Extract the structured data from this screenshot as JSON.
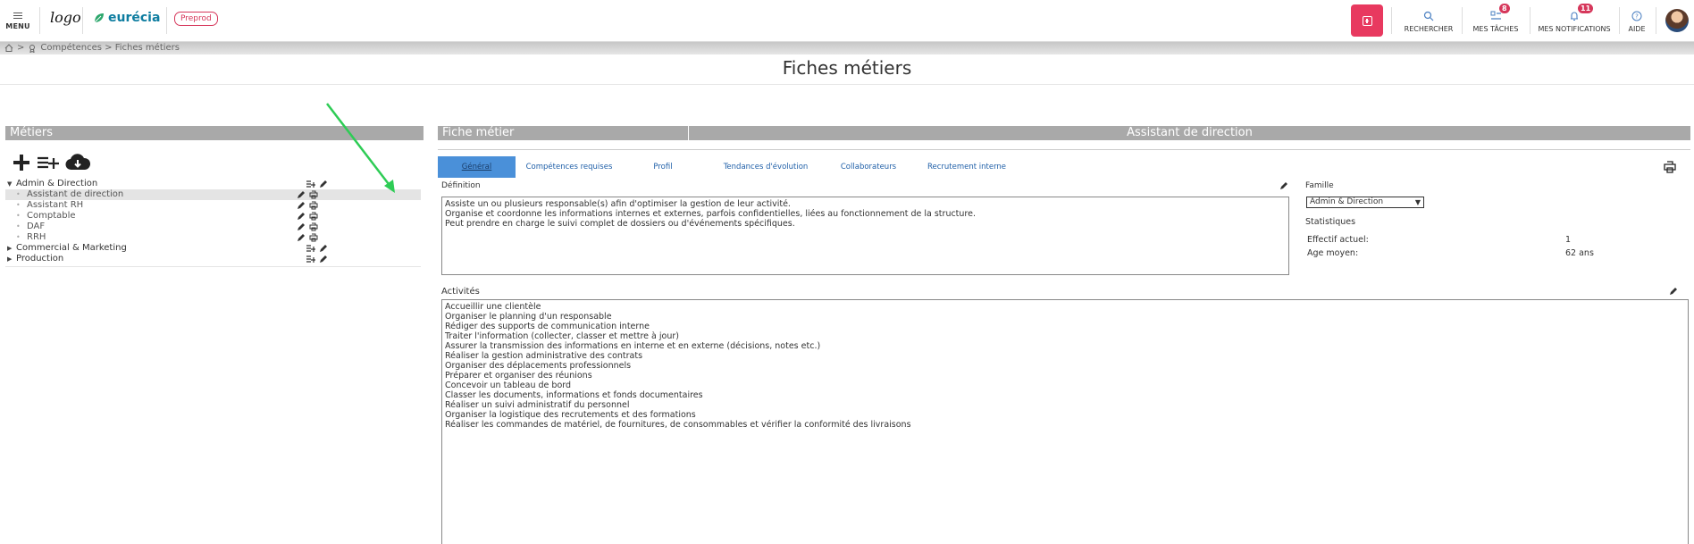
{
  "header": {
    "menu_label": "MENU",
    "logo_text": "logo",
    "brand": "eurécia",
    "env_badge": "Preprod",
    "nav": [
      {
        "label": "RECHERCHER",
        "badge": "",
        "icon": "search-icon"
      },
      {
        "label": "MES TÂCHES",
        "badge": "8",
        "icon": "tasks-icon"
      },
      {
        "label": "MES NOTIFICATIONS",
        "badge": "11",
        "icon": "bell-icon"
      },
      {
        "label": "AIDE",
        "badge": "",
        "icon": "help-icon"
      }
    ]
  },
  "breadcrumb": {
    "sep1": ">",
    "text": "Compétences > Fiches métiers"
  },
  "page_title": "Fiches métiers",
  "left": {
    "title": "Métiers",
    "tree": [
      {
        "label": "Admin & Direction",
        "type": "parent"
      },
      {
        "label": "Assistant de direction",
        "type": "child",
        "selected": true
      },
      {
        "label": "Assistant RH",
        "type": "child"
      },
      {
        "label": "Comptable",
        "type": "child"
      },
      {
        "label": "DAF",
        "type": "child"
      },
      {
        "label": "RRH",
        "type": "child"
      },
      {
        "label": "Commercial & Marketing",
        "type": "parent"
      },
      {
        "label": "Production",
        "type": "parent"
      }
    ]
  },
  "right": {
    "header_left": "Fiche métier",
    "header_right": "Assistant de direction",
    "tabs": [
      "Général",
      "Compétences requises",
      "Profil",
      "Tendances d'évolution",
      "Collaborateurs",
      "Recrutement interne"
    ],
    "definition_label": "Définition",
    "definition_text": "Assiste un ou plusieurs responsable(s) afin d'optimiser la gestion de leur activité.\nOrganise et coordonne les informations internes et externes, parfois confidentielles, liées au fonctionnement de la structure.\nPeut prendre en charge le suivi complet de dossiers ou d'événements spécifiques.",
    "famille_label": "Famille",
    "famille_value": "Admin & Direction",
    "stats_label": "Statistiques",
    "effectif_label": "Effectif actuel:",
    "effectif_value": "1",
    "age_label": "Age moyen:",
    "age_value": "62 ans",
    "activites_label": "Activités",
    "activites_text": "Accueillir une clientèle\nOrganiser le planning d'un responsable\nRédiger des supports de communication interne\nTraiter l'information (collecter, classer et mettre à jour)\nAssurer la transmission des informations en interne et en externe (décisions, notes etc.)\nRéaliser la gestion administrative des contrats\nOrganiser des déplacements professionnels\nPréparer et organiser des réunions\nConcevoir un tableau de bord\nClasser les documents, informations et fonds documentaires\nRéaliser un suivi administratif du personnel\nOrganiser la logistique des recrutements et des formations\nRéaliser les commandes de matériel, de fournitures, de consommables et vérifier la conformité des livraisons"
  },
  "colors": {
    "accent": "#e8395f",
    "tab_active": "#4a90d9",
    "header_grey": "#a9a9a9",
    "brand": "#0e7da0"
  }
}
